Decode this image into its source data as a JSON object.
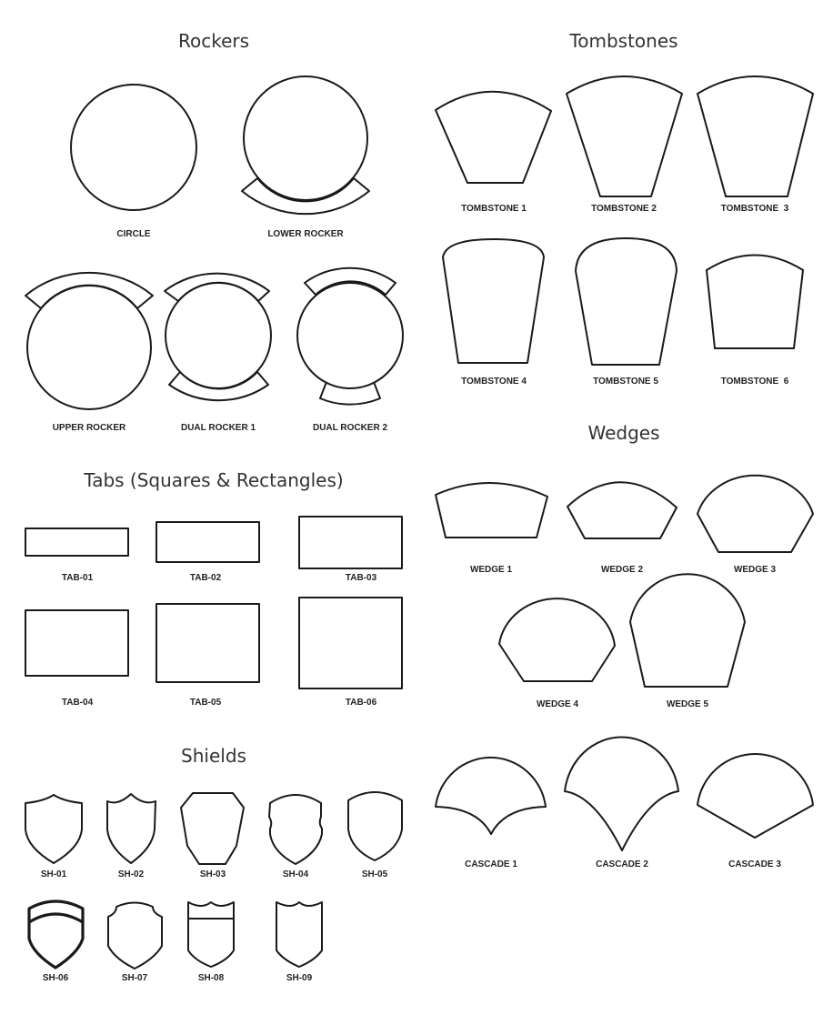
{
  "sections": {
    "rockers": {
      "title": "Rockers",
      "items": [
        "CIRCLE",
        "LOWER ROCKER",
        "UPPER ROCKER",
        "DUAL ROCKER 1",
        "DUAL ROCKER 2"
      ]
    },
    "tombstones": {
      "title": "Tombstones",
      "items": [
        "TOMBSTONE 1",
        "TOMBSTONE 2",
        "TOMBSTONE  3",
        "TOMBSTONE 4",
        "TOMBSTONE 5",
        "TOMBSTONE  6"
      ]
    },
    "tabs": {
      "title": "Tabs (Squares & Rectangles)",
      "items": [
        "TAB-01",
        "TAB-02",
        "TAB-03",
        "TAB-04",
        "TAB-05",
        "TAB-06"
      ]
    },
    "wedges": {
      "title": "Wedges",
      "items": [
        "WEDGE 1",
        "WEDGE 2",
        "WEDGE 3",
        "WEDGE 4",
        "WEDGE 5"
      ]
    },
    "cascades": {
      "items": [
        "CASCADE 1",
        "CASCADE 2",
        "CASCADE 3"
      ]
    },
    "shields": {
      "title": "Shields",
      "items": [
        "SH-01",
        "SH-02",
        "SH-03",
        "SH-04",
        "SH-05",
        "SH-06",
        "SH-07",
        "SH-08",
        "SH-09"
      ]
    }
  }
}
